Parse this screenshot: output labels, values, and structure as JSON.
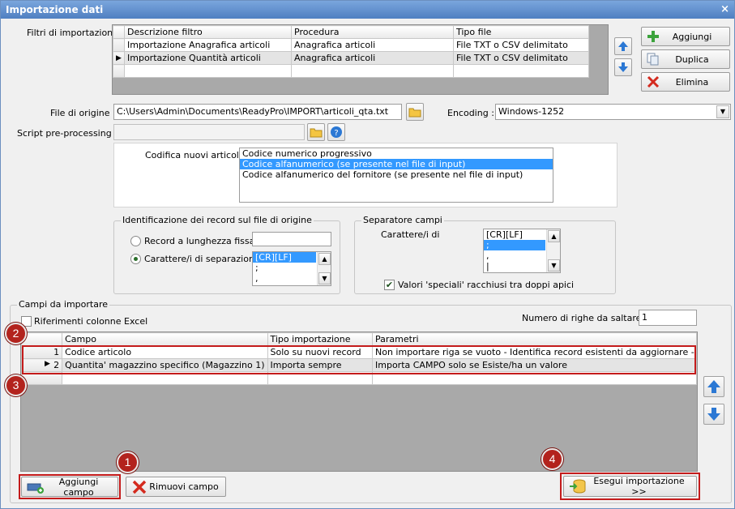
{
  "window": {
    "title": "Importazione dati",
    "close_glyph": "×"
  },
  "filters": {
    "label": "Filtri di importazione :",
    "columns": [
      "Descrizione filtro",
      "Procedura",
      "Tipo file"
    ],
    "rows": [
      {
        "descrizione": "Importazione Anagrafica articoli",
        "procedura": "Anagrafica articoli",
        "tipo": "File TXT o CSV delimitato"
      },
      {
        "descrizione": "Importazione Quantità articoli",
        "procedura": "Anagrafica articoli",
        "tipo": "File TXT o CSV delimitato"
      }
    ],
    "current_row_marker": "▶",
    "buttons": {
      "add": "Aggiungi",
      "duplicate": "Duplica",
      "delete": "Elimina"
    }
  },
  "source": {
    "label": "File di origine :",
    "value": "C:\\Users\\Admin\\Documents\\ReadyPro\\IMPORT\\articoli_qta.txt",
    "encoding_label": "Encoding :",
    "encoding_value": "Windows-1252",
    "script_label": "Script pre-processing :",
    "script_value": ""
  },
  "codifica": {
    "label": "Codifica nuovi articoli :",
    "options": [
      "Codice numerico progressivo",
      "Codice alfanumerico (se presente nel file di input)",
      "Codice alfanumerico del fornitore (se presente nel file di input)"
    ],
    "selected_index": 1
  },
  "identificazione": {
    "title": "Identificazione dei record sul file di origine",
    "radio_fixed": "Record a lunghezza fissa",
    "radio_sep": "Carattere/i di separazione",
    "fixed_value": "",
    "sep_items": [
      "[CR][LF]",
      ";",
      ","
    ]
  },
  "separatore": {
    "title": "Separatore campi",
    "label": "Carattere/i di",
    "items": [
      "[CR][LF]",
      ";",
      ",",
      "|"
    ],
    "checkbox_label": "Valori 'speciali' racchiusi tra doppi apici",
    "checkbox_mark": "✔"
  },
  "campi": {
    "title": "Campi da importare",
    "excel_label": "Riferimenti colonne Excel",
    "skip_label": "Numero di righe da saltare :",
    "skip_value": "1",
    "columns": [
      "Campo",
      "Tipo importazione",
      "Parametri"
    ],
    "rows": [
      {
        "n": "1",
        "campo": "Codice articolo",
        "tipo": "Solo su nuovi record",
        "parametri": "Non importare riga se vuoto - Identifica record esistenti da aggiornare - Importa C..."
      },
      {
        "n": "2",
        "campo": "Quantita' magazzino specifico (Magazzino 1)",
        "tipo": "Importa sempre",
        "parametri": "Importa CAMPO solo se Esiste/ha un valore"
      }
    ],
    "current_row_marker": "▶"
  },
  "bottom": {
    "add_field": "Aggiungi campo",
    "remove_field": "Rimuovi campo",
    "run": "Esegui importazione >>"
  },
  "badges": [
    "1",
    "2",
    "3",
    "4"
  ],
  "colors": {
    "accent_red": "#c41b1b",
    "badge_red": "#b3231d",
    "selection_blue": "#3399ff",
    "title_blue": "#4f7fc1"
  }
}
